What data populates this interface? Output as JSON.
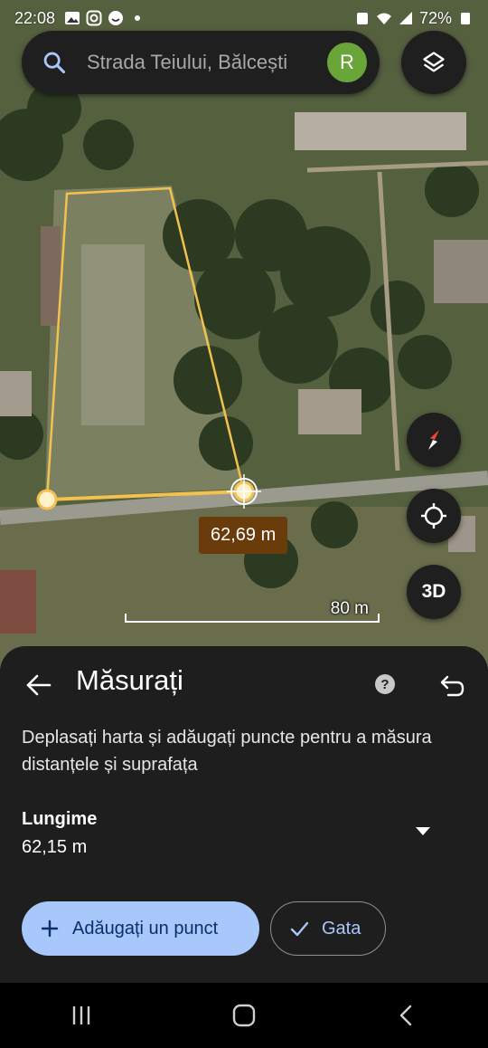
{
  "status_bar": {
    "time": "22:08",
    "battery": "72%"
  },
  "search": {
    "query": "Strada Teiului, Bălcești",
    "avatar_initial": "R"
  },
  "map": {
    "measured_segment": "62,69 m",
    "scale_label": "80 m",
    "button_3d": "3D",
    "colors": {
      "polygon": "#f2c14e",
      "label_bg": "#6b3c0b"
    }
  },
  "sheet": {
    "title": "Măsurați",
    "instructions": "Deplasați harta și adăugați puncte pentru a măsura distanțele și suprafața",
    "length_label": "Lungime",
    "length_value": "62,15 m",
    "add_point_label": "Adăugați un punct",
    "done_label": "Gata"
  },
  "icons": [
    "search-icon",
    "layers-icon",
    "compass-icon",
    "my-location-icon",
    "back-arrow-icon",
    "help-icon",
    "undo-icon",
    "dropdown-icon",
    "plus-icon",
    "check-icon",
    "recents-icon",
    "home-icon",
    "back-icon"
  ]
}
